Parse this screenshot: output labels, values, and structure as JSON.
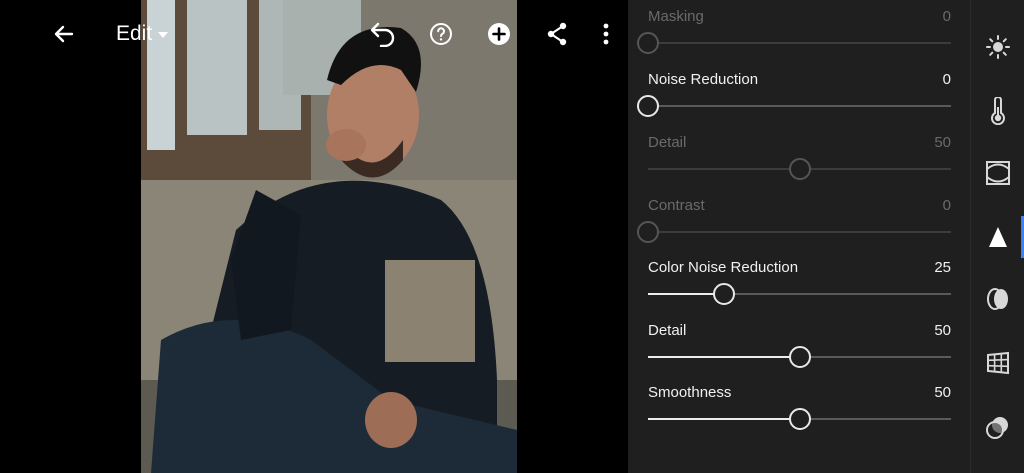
{
  "toolbar": {
    "back_icon": "arrow-left-icon",
    "edit_label": "Edit",
    "undo_icon": "undo-icon",
    "help_icon": "help-circle-icon",
    "add_icon": "plus-circle-icon",
    "share_icon": "share-icon",
    "more_icon": "more-vertical-icon"
  },
  "panel": {
    "rows": [
      {
        "label": "Masking",
        "value": "0",
        "level": 0,
        "enabled": false
      },
      {
        "label": "Noise Reduction",
        "value": "0",
        "level": 0,
        "enabled": true
      },
      {
        "label": "Detail",
        "value": "50",
        "level": 0.5,
        "enabled": false
      },
      {
        "label": "Contrast",
        "value": "0",
        "level": 0,
        "enabled": false
      },
      {
        "label": "Color Noise Reduction",
        "value": "25",
        "level": 0.25,
        "enabled": true
      },
      {
        "label": "Detail",
        "value": "50",
        "level": 0.5,
        "enabled": true
      },
      {
        "label": "Smoothness",
        "value": "50",
        "level": 0.5,
        "enabled": true
      }
    ]
  },
  "rail": {
    "items": [
      "light-icon",
      "color-temperature-icon",
      "effects-icon",
      "detail-icon",
      "optics-icon",
      "geometry-icon",
      "presets-icon"
    ],
    "active_index": 3,
    "accent": "#3b82f6"
  }
}
